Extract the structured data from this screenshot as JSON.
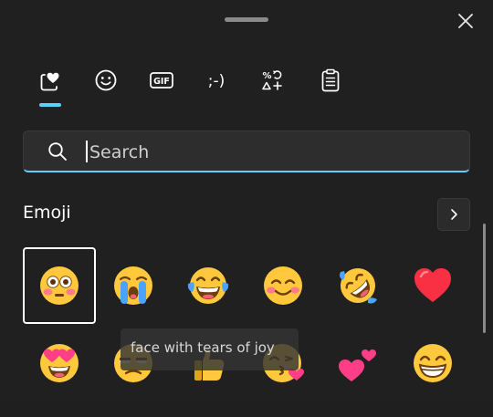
{
  "tabs": [
    {
      "id": "recent",
      "icon": "favorites-heart-icon",
      "active": true
    },
    {
      "id": "emoji",
      "icon": "smiley-icon",
      "active": false
    },
    {
      "id": "gif",
      "icon": "gif-icon",
      "label": "GIF",
      "active": false
    },
    {
      "id": "kaomoji",
      "icon": "kaomoji-icon",
      "label": ";-)",
      "active": false
    },
    {
      "id": "symbols",
      "icon": "symbols-icon",
      "active": false
    },
    {
      "id": "clipboard",
      "icon": "clipboard-icon",
      "active": false
    }
  ],
  "search": {
    "placeholder": "Search",
    "value": ""
  },
  "section": {
    "title": "Emoji"
  },
  "emoji_rows": [
    [
      {
        "name": "flushed face",
        "selected": true
      },
      {
        "name": "loudly crying face"
      },
      {
        "name": "face with tears of joy"
      },
      {
        "name": "smiling face with smiling eyes"
      },
      {
        "name": "rolling on the floor laughing"
      },
      {
        "name": "red heart"
      }
    ],
    [
      {
        "name": "smiling face with heart-eyes"
      },
      {
        "name": "unamused face"
      },
      {
        "name": "thumbs up"
      },
      {
        "name": "face blowing a kiss"
      },
      {
        "name": "two hearts"
      },
      {
        "name": "beaming face with smiling eyes"
      }
    ]
  ],
  "tooltip": {
    "text": "face with tears of joy"
  },
  "colors": {
    "background": "#202020",
    "accent": "#60cdff",
    "emoji_yellow": "#ffc83d",
    "heart_red": "#f92f43",
    "heart_pink": "#ff3e87"
  }
}
